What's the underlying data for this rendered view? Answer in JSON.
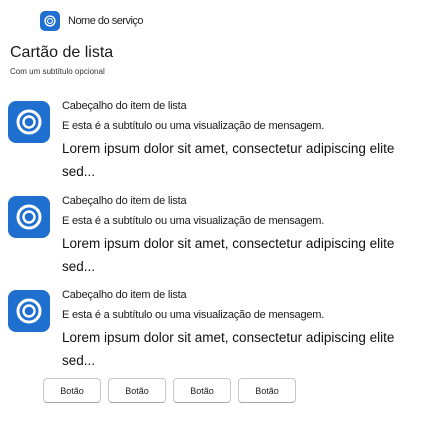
{
  "service": {
    "name": "Nome do serviço",
    "icon": "ring-logo-icon"
  },
  "card": {
    "title": "Cartão de lista",
    "subtitle": "Com um subtítulo opcional"
  },
  "list_items": [
    {
      "header": "Cabeçalho do item de lista",
      "subtitle": "E esta é a subtítulo ou uma visualização de mensagem.",
      "body": "Lorem ipsum dolor sit amet, consectetur adipiscing elite sed...",
      "icon": "ring-logo-icon"
    },
    {
      "header": "Cabeçalho do item de lista",
      "subtitle": "E esta é a subtítulo ou uma visualização de mensagem.",
      "body": "Lorem ipsum dolor sit amet, consectetur adipiscing elite sed...",
      "icon": "ring-logo-icon"
    },
    {
      "header": "Cabeçalho do item de lista",
      "subtitle": "E esta é a subtítulo ou uma visualização de mensagem.",
      "body": "Lorem ipsum dolor sit amet, consectetur adipiscing elite sed...",
      "icon": "ring-logo-icon"
    }
  ],
  "buttons": [
    {
      "label": "Botão"
    },
    {
      "label": "Botão"
    },
    {
      "label": "Botão"
    },
    {
      "label": "Botão"
    }
  ],
  "colors": {
    "accent": "#1f6fcf",
    "text": "#1a1a1a",
    "button_border": "#c8c8c8"
  }
}
